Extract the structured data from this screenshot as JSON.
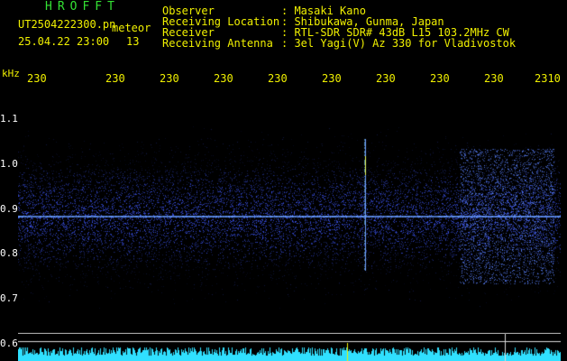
{
  "header": {
    "brand": "HROFFT",
    "filename": "UT2504222300.pn",
    "meteor_label": "meteor",
    "date_time": "25.04.22 23:00",
    "meteor_count": "13",
    "fields": [
      {
        "label": "Observer",
        "value": ": Masaki Kano"
      },
      {
        "label": "Receiving Location",
        "value": ": Shibukawa, Gunma, Japan"
      },
      {
        "label": "Receiver",
        "value": ": RTL-SDR SDR# 43dB L15 103.2MHz CW"
      },
      {
        "label": "Receiving Antenna",
        "value": ": 3el Yagi(V) Az 330 for Vladivostok"
      }
    ]
  },
  "axis": {
    "y_unit": "kHz",
    "y_ticks": [
      "1.1",
      "1.0",
      "0.9",
      "0.8",
      "0.7",
      "0.6"
    ],
    "x_ticks": [
      "230",
      "230",
      "230",
      "230",
      "230",
      "230",
      "230",
      "230",
      "230",
      "2310"
    ]
  },
  "colors": {
    "header_green": "#34e234",
    "tick_yellow": "#f0f000",
    "signal_blue": "#2a4cff",
    "noise_cyan": "#30e0ff"
  }
}
